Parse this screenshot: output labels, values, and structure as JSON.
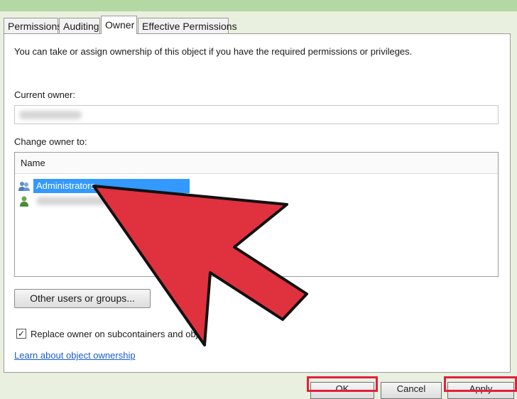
{
  "tabs": [
    "Permissions",
    "Auditing",
    "Owner",
    "Effective Permissions"
  ],
  "active_tab": "Owner",
  "description": "You can take or assign ownership of this object if you have the required permissions or privileges.",
  "current_owner_label": "Current owner:",
  "change_owner_label": "Change owner to:",
  "list": {
    "header": "Name",
    "items": [
      {
        "label": "Administrators",
        "icon": "user-group-icon",
        "selected": true
      },
      {
        "label": "",
        "icon": "user-icon",
        "selected": false
      }
    ]
  },
  "other_users_button": "Other users or groups...",
  "replace_owner_checkbox": {
    "label": "Replace owner on subcontainers and obje",
    "checked": true
  },
  "learn_link": "Learn about object ownership",
  "bottom_buttons": [
    "OK",
    "Cancel",
    "Apply"
  ],
  "colors": {
    "arrow": "#e0313f",
    "highlight": "#e0213a",
    "selection": "#3399ff",
    "link": "#1a5dc9"
  }
}
